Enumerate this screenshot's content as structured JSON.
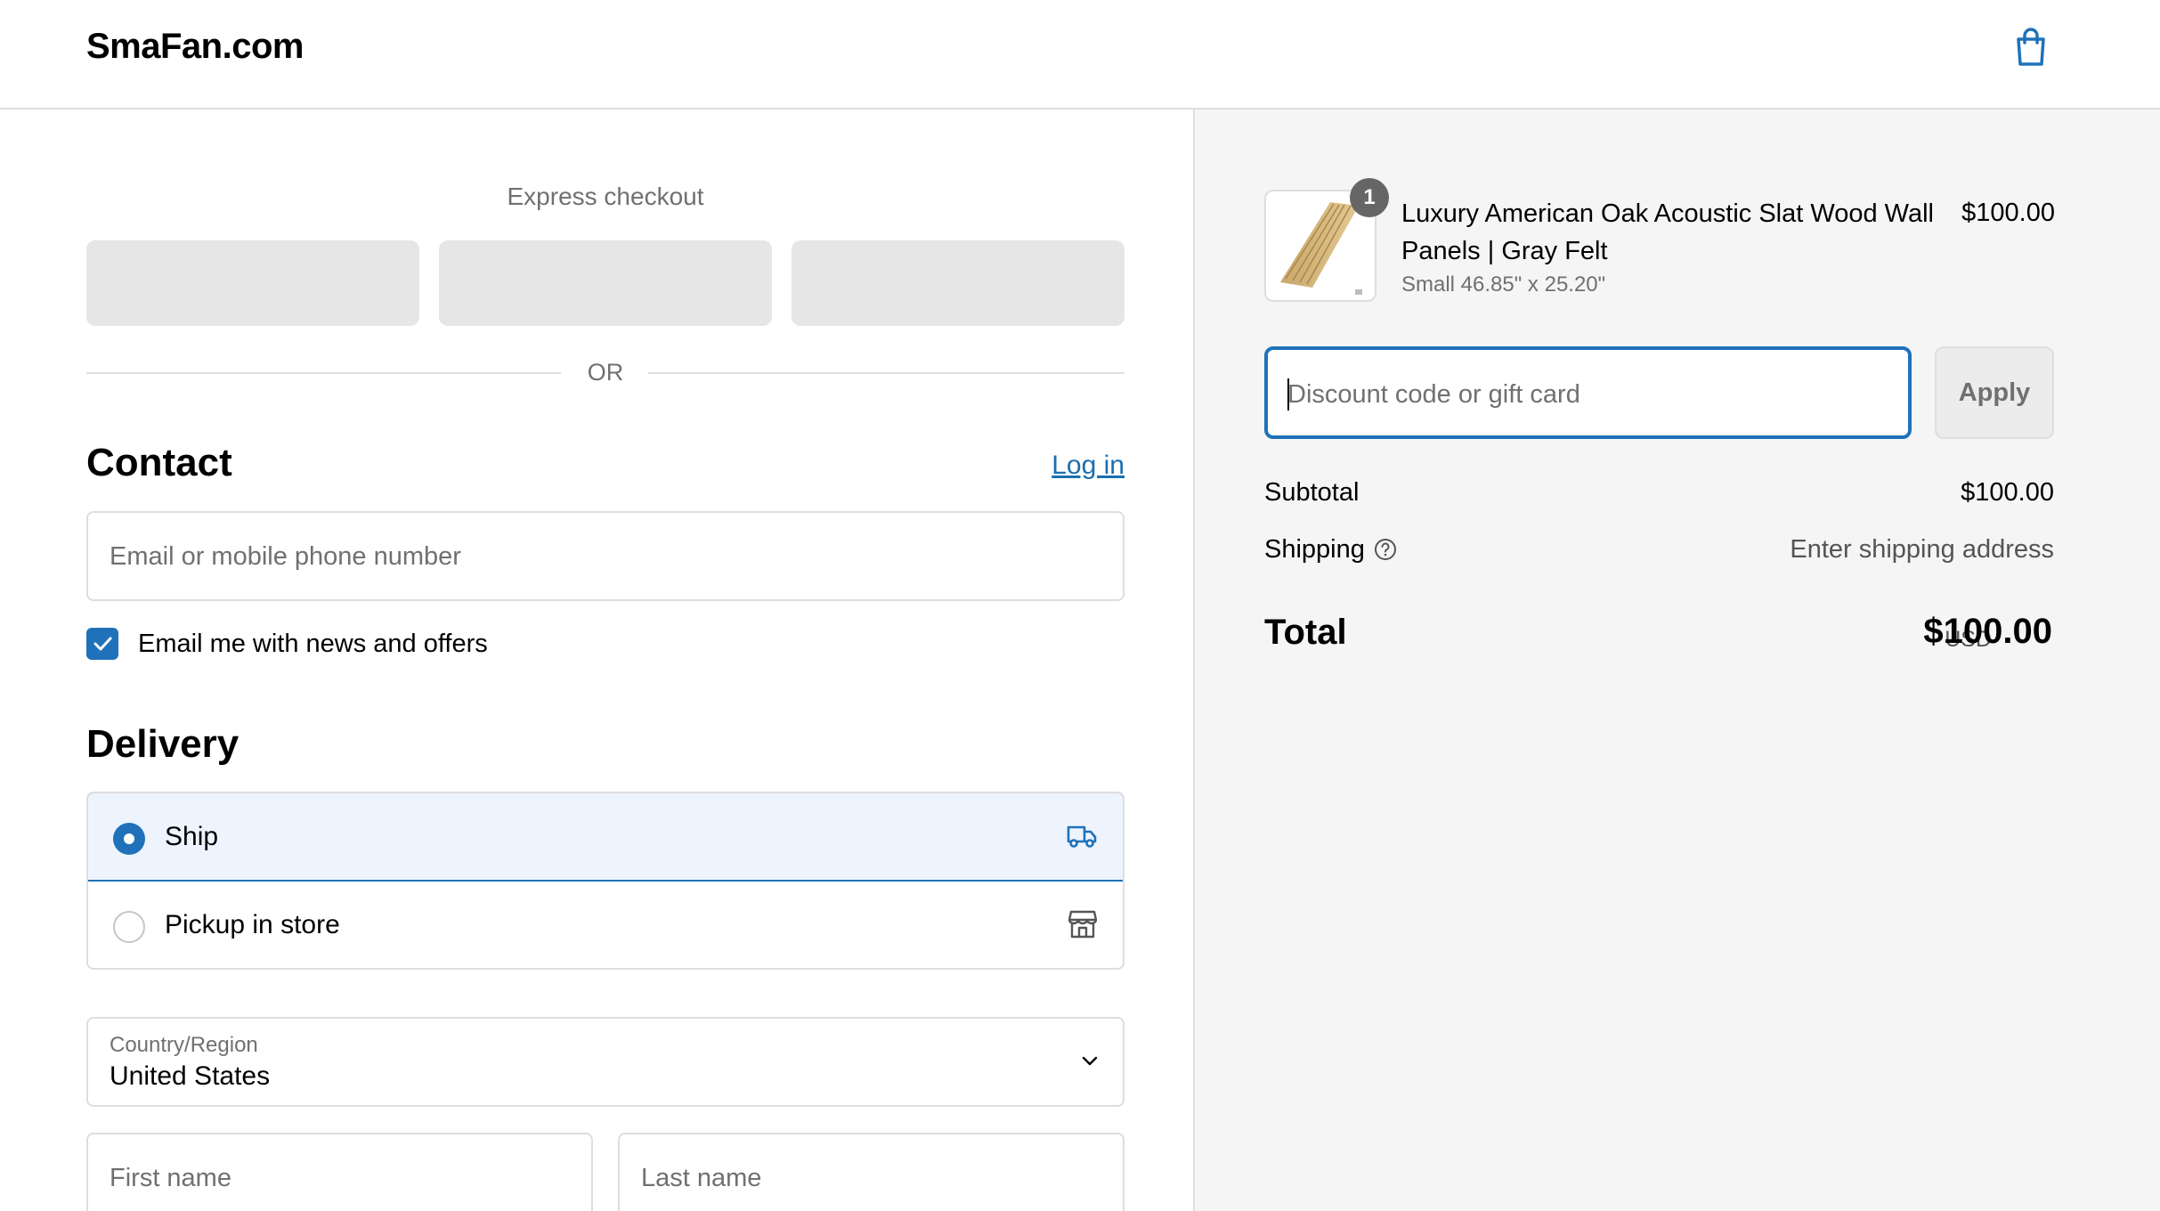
{
  "header": {
    "logo": "SmaFan.com",
    "cart_icon": "shopping-bag-icon"
  },
  "express": {
    "label": "Express checkout",
    "or": "OR"
  },
  "contact": {
    "title": "Contact",
    "login": "Log in",
    "email_placeholder": "Email or mobile phone number",
    "newsletter_label": "Email me with news and offers",
    "newsletter_checked": true
  },
  "delivery": {
    "title": "Delivery",
    "options": [
      {
        "label": "Ship",
        "selected": true,
        "icon": "truck-icon"
      },
      {
        "label": "Pickup in store",
        "selected": false,
        "icon": "store-icon"
      }
    ],
    "country_label": "Country/Region",
    "country_value": "United States",
    "first_name_placeholder": "First name",
    "last_name_placeholder": "Last name"
  },
  "order": {
    "quantity": "1",
    "product_name": "Luxury American Oak Acoustic Slat Wood Wall Panels | Gray Felt",
    "variant": "Small 46.85\" x 25.20\"",
    "price": "$100.00",
    "discount_placeholder": "Discount code or gift card",
    "apply_label": "Apply",
    "subtotal_label": "Subtotal",
    "subtotal_value": "$100.00",
    "shipping_label": "Shipping",
    "shipping_value": "Enter shipping address",
    "total_label": "Total",
    "total_currency": "USD",
    "total_value": "$100.00"
  },
  "colors": {
    "accent": "#1f72b9",
    "link": "#1a6fb0",
    "muted_text": "#707070",
    "border": "#dedede",
    "summary_bg": "#f5f5f5"
  }
}
